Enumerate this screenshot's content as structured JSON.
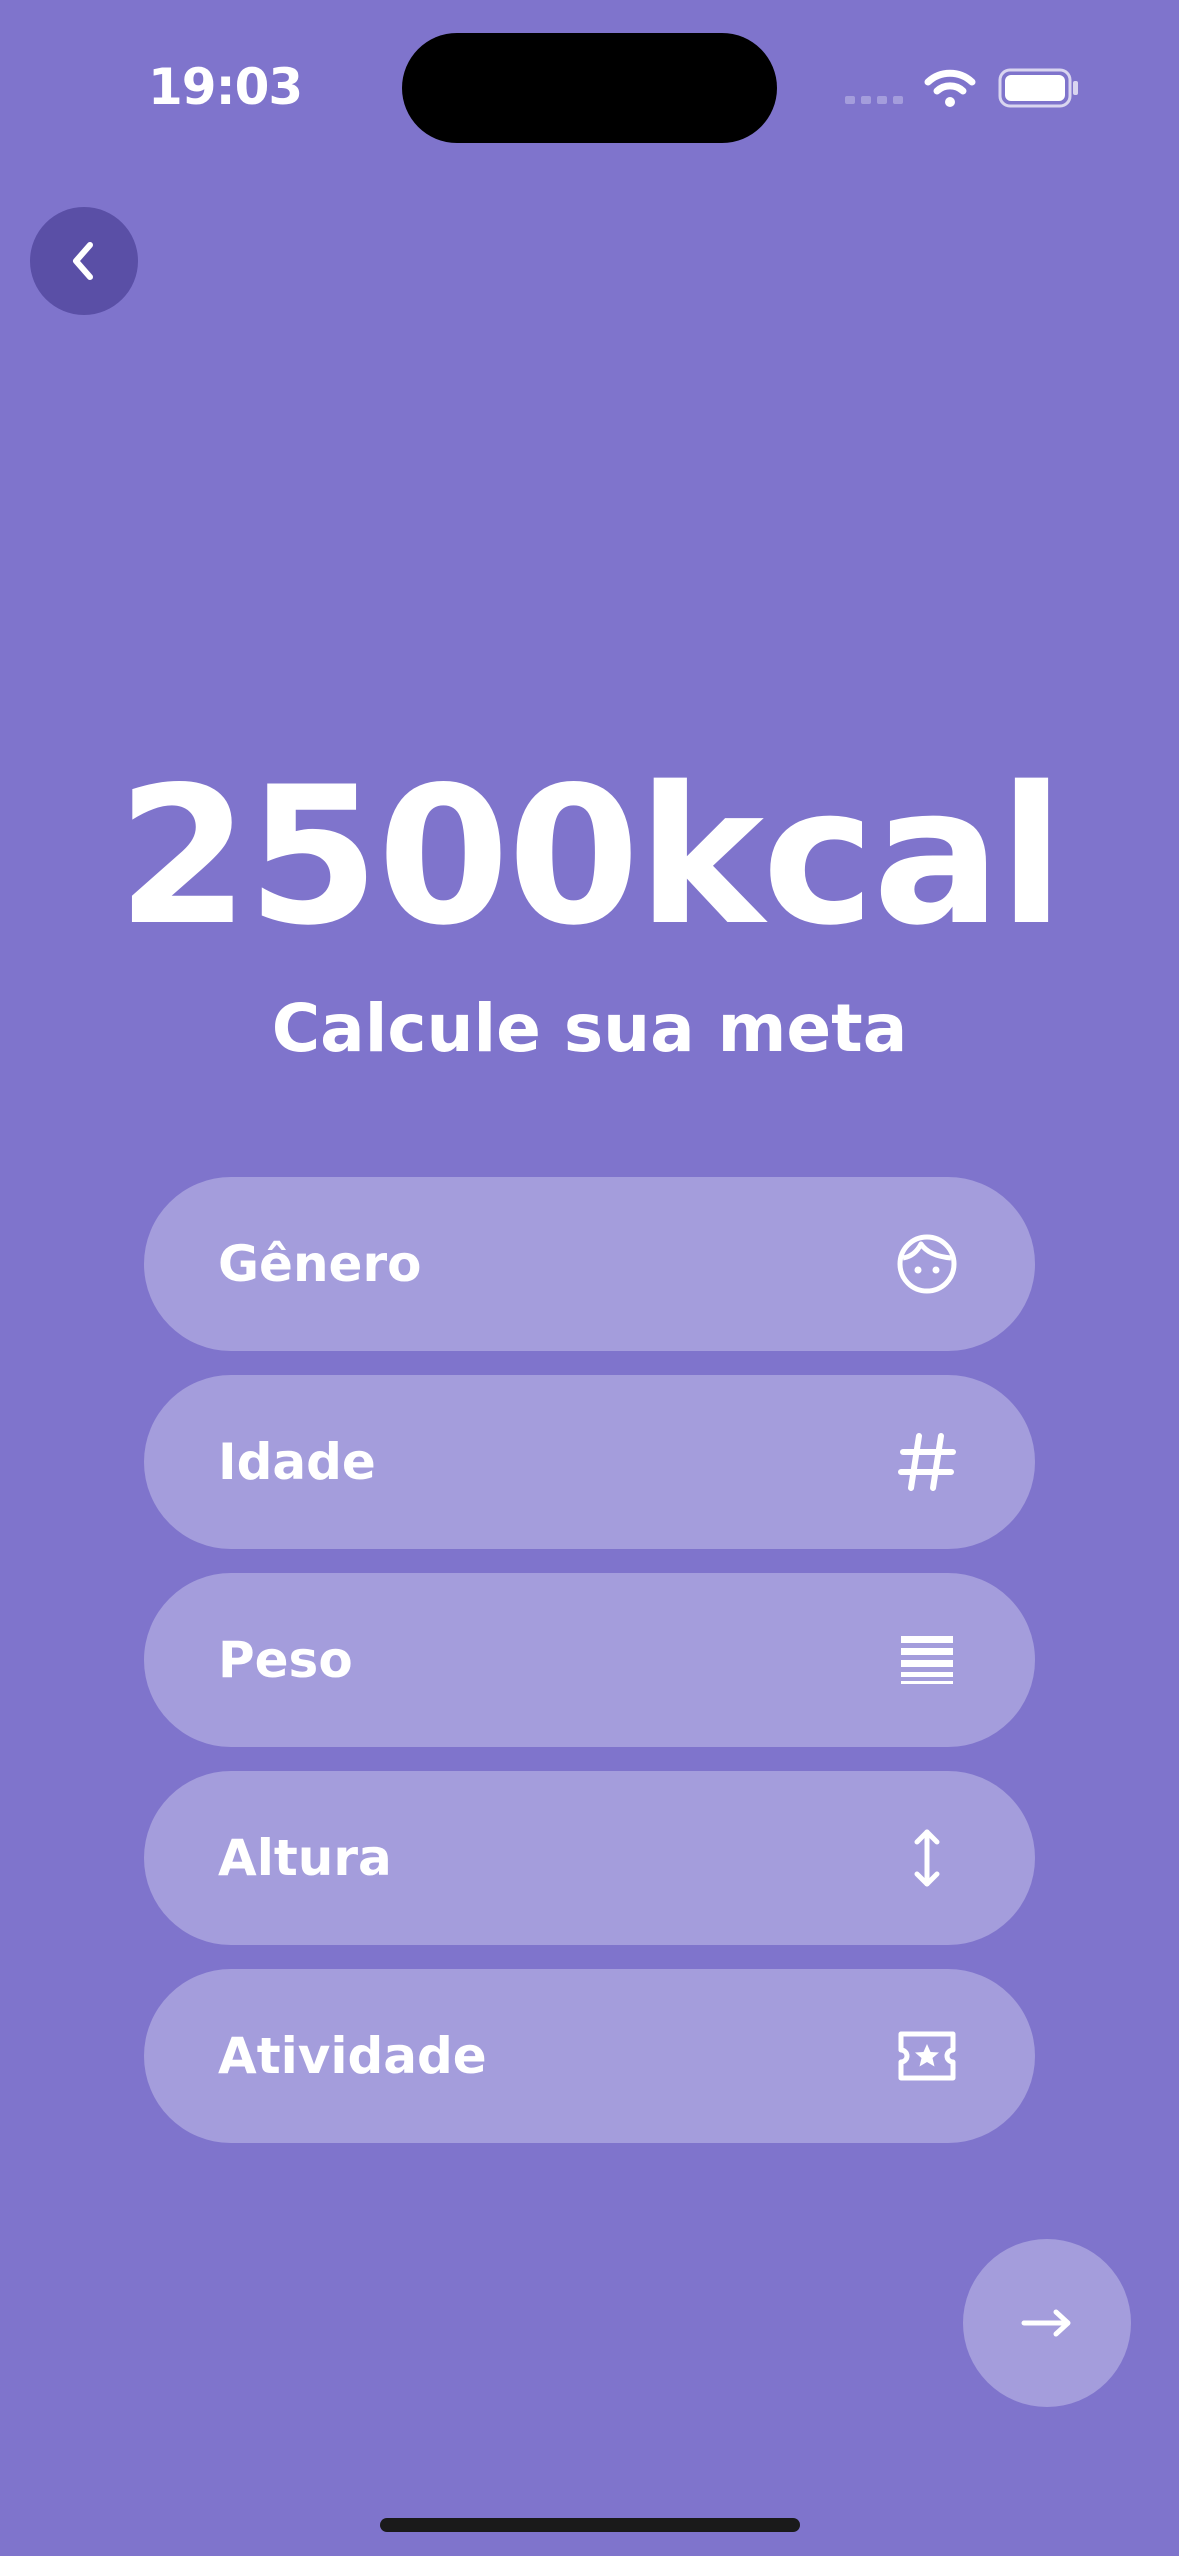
{
  "status_bar": {
    "time": "19:03"
  },
  "header": {
    "back_icon": "chevron-left-icon"
  },
  "main": {
    "kcal_value": "2500kcal",
    "subtitle": "Calcule sua meta",
    "fields": [
      {
        "label": "Gênero",
        "icon": "face-icon"
      },
      {
        "label": "Idade",
        "icon": "hash-icon"
      },
      {
        "label": "Peso",
        "icon": "weight-lines-icon"
      },
      {
        "label": "Altura",
        "icon": "vertical-arrows-icon"
      },
      {
        "label": "Atividade",
        "icon": "star-ticket-icon"
      }
    ]
  },
  "footer": {
    "next_icon": "arrow-right-icon"
  },
  "colors": {
    "background": "#7f74cc",
    "field_background": "#a49ddc",
    "back_button": "#5a4fa6",
    "text": "#ffffff"
  }
}
